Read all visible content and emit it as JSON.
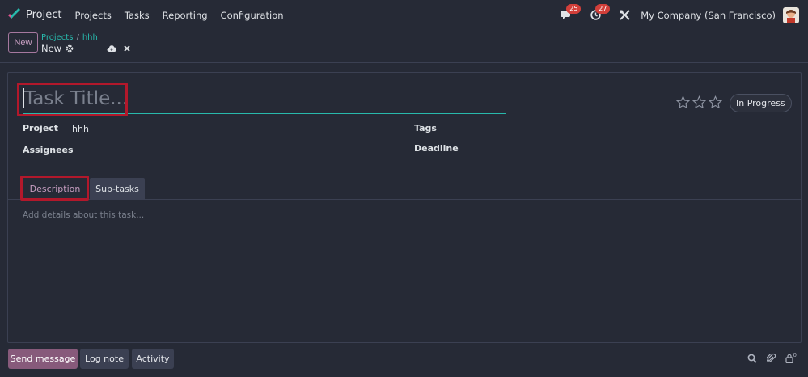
{
  "navbar": {
    "app_name": "Project",
    "menu": [
      "Projects",
      "Tasks",
      "Reporting",
      "Configuration"
    ],
    "messages_count": "25",
    "activities_count": "27",
    "company": "My Company (San Francisco)"
  },
  "control": {
    "new_label": "New",
    "breadcrumb": [
      "Projects",
      "hhh"
    ],
    "record_name": "New"
  },
  "form": {
    "title_placeholder": "Task Title...",
    "status": "In Progress",
    "project_label": "Project",
    "project_value": "hhh",
    "assignees_label": "Assignees",
    "tags_label": "Tags",
    "deadline_label": "Deadline",
    "tabs": [
      "Description",
      "Sub-tasks"
    ],
    "description_placeholder": "Add details about this task..."
  },
  "chatter": {
    "send_message": "Send message",
    "log_note": "Log note",
    "activity": "Activity",
    "followers_count": "0"
  },
  "colors": {
    "background": "#262a36",
    "accent_teal": "#28b9ac",
    "primary_purple": "#875a7b",
    "highlight_red": "#b2182b",
    "badge_red": "#d23f3a"
  }
}
